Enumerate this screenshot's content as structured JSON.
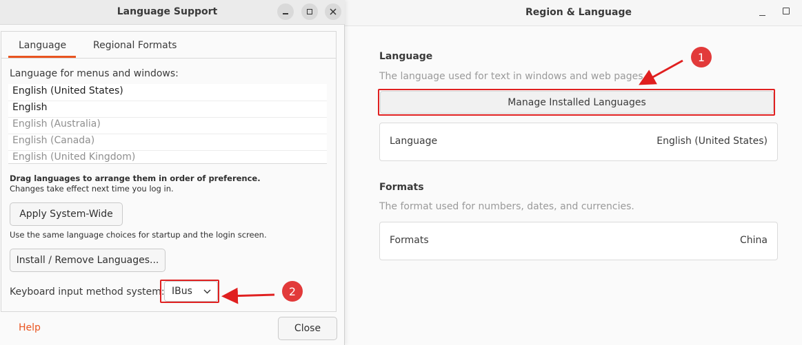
{
  "region_window": {
    "title": "Region & Language",
    "language_section": {
      "heading": "Language",
      "description": "The language used for text in windows and web pages.",
      "manage_button": "Manage Installed Languages",
      "row_label": "Language",
      "row_value": "English (United States)"
    },
    "formats_section": {
      "heading": "Formats",
      "description": "The format used for numbers, dates, and currencies.",
      "row_label": "Formats",
      "row_value": "China"
    }
  },
  "dialog": {
    "title": "Language Support",
    "tabs": [
      {
        "label": "Language",
        "active": true
      },
      {
        "label": "Regional Formats",
        "active": false
      }
    ],
    "list_label": "Language for menus and windows:",
    "languages": [
      {
        "label": "English (United States)",
        "enabled": true
      },
      {
        "label": "English",
        "enabled": true
      },
      {
        "label": "English (Australia)",
        "enabled": false
      },
      {
        "label": "English (Canada)",
        "enabled": false
      },
      {
        "label": "English (United Kingdom)",
        "enabled": false
      }
    ],
    "drag_hint_bold": "Drag languages to arrange them in order of preference.",
    "drag_hint": "Changes take effect next time you log in.",
    "apply_button": "Apply System-Wide",
    "apply_hint": "Use the same language choices for startup and the login screen.",
    "install_button": "Install / Remove Languages...",
    "keyboard_label": "Keyboard input method system:",
    "keyboard_value": "IBus",
    "help_label": "Help",
    "close_button": "Close"
  },
  "annotations": {
    "badge_1": "1",
    "badge_2": "2",
    "color": "#e23a3a"
  },
  "colors": {
    "accent": "#e95420",
    "annotation_red": "#e02020"
  }
}
